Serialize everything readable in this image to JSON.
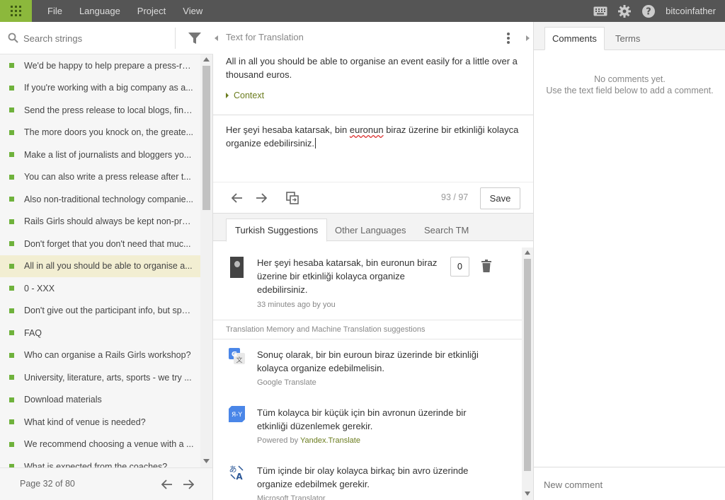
{
  "menu": {
    "items": [
      "File",
      "Language",
      "Project",
      "View"
    ]
  },
  "user": {
    "name": "bitcoinfather"
  },
  "search": {
    "placeholder": "Search strings"
  },
  "strings": [
    "We'd be happy to help prepare a press-re...",
    "If you're working with a big company as a...",
    "Send the press release to local blogs, find...",
    "The more doors you knock on, the greate...",
    "Make a list of journalists and bloggers yo...",
    "You can also write a press release after t...",
    "Also non-traditional technology companie...",
    "Rails Girls should always be kept non-pro...",
    "Don't forget that you don't need that muc...",
    "All in all you should be able to organise a...",
    "0 - XXX",
    "Don't give out the participant info, but spo...",
    "FAQ",
    "Who can organise a Rails Girls workshop?",
    "University, literature, arts, sports - we try ...",
    "Download materials",
    "What kind of venue is needed?",
    "We recommend choosing a venue with a ...",
    "What is expected from the coaches?"
  ],
  "pager": {
    "label": "Page 32 of 80"
  },
  "source": {
    "header": "Text for Translation",
    "text": "All in all you should be able to organise an event easily for a little over a thousand euros.",
    "context_label": "Context"
  },
  "translation": {
    "part1": "Her şeyi hesaba katarsak, bin ",
    "misspelled": "euronun",
    "part2": " biraz üzerine bir etkinliği kolayca organize edebilirsiniz.",
    "count": "93 / 97",
    "save_label": "Save"
  },
  "suggestion_tabs": [
    "Turkish Suggestions",
    "Other Languages",
    "Search TM"
  ],
  "own_suggestion": {
    "text": "Her şeyi hesaba katarsak, bin euronun biraz üzerine bir etkinliği kolayca organize edebilirsiniz.",
    "meta": "33 minutes ago by you",
    "votes": "0"
  },
  "tm_header": "Translation Memory and Machine Translation suggestions",
  "mt_suggestions": [
    {
      "text": "Sonuç olarak, bir bin euroun biraz üzerinde bir etkinliği kolayca organize edebilmelisin.",
      "source": "Google Translate",
      "icon": "google-translate-icon"
    },
    {
      "text": "Tüm kolayca bir küçük için bin avronun üzerinde bir etkinliği düzenlemek gerekir.",
      "source_prefix": "Powered by ",
      "source": "Yandex.Translate",
      "icon": "yandex-translate-icon"
    },
    {
      "text": "Tüm içinde bir olay kolayca birkaç bin avro üzerinde organize edebilmek gerekir.",
      "source": "Microsoft Translator",
      "icon": "microsoft-translator-icon"
    }
  ],
  "right_tabs": [
    "Comments",
    "Terms"
  ],
  "comments": {
    "empty_line1": "No comments yet.",
    "empty_line2": "Use the text field below to add a comment.",
    "new_placeholder": "New comment"
  },
  "colors": {
    "topbar": "#555555",
    "accent_green": "#8cb83c",
    "status_green": "#6fb23c",
    "selected_row": "#f2eed2"
  }
}
